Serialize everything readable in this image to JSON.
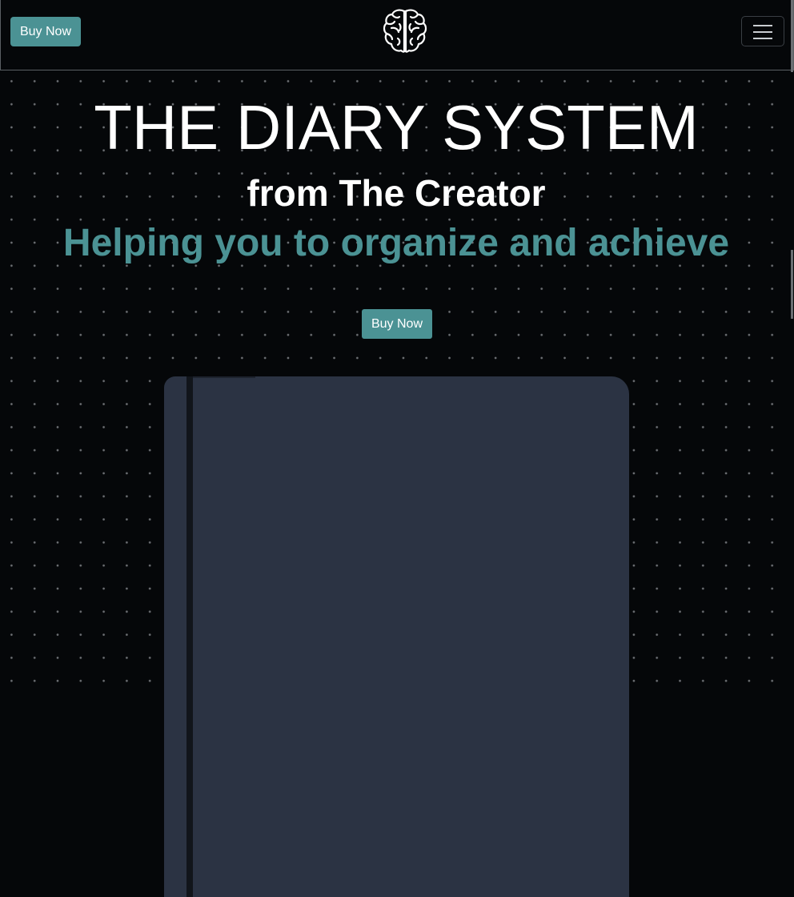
{
  "navbar": {
    "buy_label": "Buy Now",
    "logo_icon": "brain-icon",
    "menu_icon": "hamburger-menu-icon"
  },
  "hero": {
    "title": "THE DIARY SYSTEM",
    "subtitle": "from The Creator",
    "tagline": "Helping you to organize and achieve",
    "buy_label": "Buy Now"
  },
  "diary": {
    "image": "diary-book-illustration"
  },
  "colors": {
    "background": "#050709",
    "accent": "#4b9294",
    "diary_cover": "#2b3343",
    "text": "#ffffff"
  }
}
